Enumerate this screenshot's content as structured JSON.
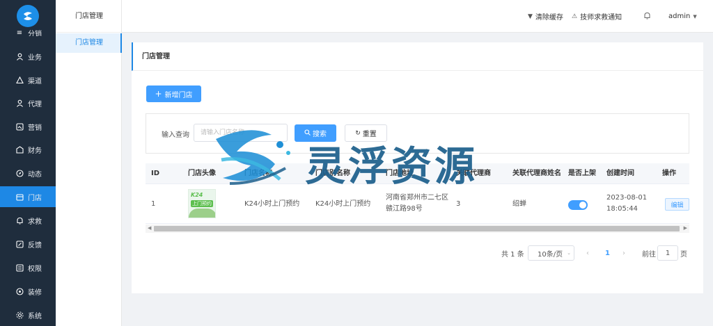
{
  "nav": {
    "partial_item": "分销",
    "items": [
      {
        "label": "业务",
        "icon": "user-icon"
      },
      {
        "label": "渠道",
        "icon": "share-icon"
      },
      {
        "label": "代理",
        "icon": "agent-icon"
      },
      {
        "label": "营销",
        "icon": "marketing-icon"
      },
      {
        "label": "财务",
        "icon": "finance-icon"
      },
      {
        "label": "动态",
        "icon": "compass-icon"
      },
      {
        "label": "门店",
        "icon": "store-icon"
      },
      {
        "label": "求救",
        "icon": "bell-icon"
      },
      {
        "label": "反馈",
        "icon": "feedback-icon"
      },
      {
        "label": "权限",
        "icon": "permission-icon"
      },
      {
        "label": "装修",
        "icon": "decoration-icon"
      },
      {
        "label": "系统",
        "icon": "settings-icon"
      }
    ],
    "active_index": 6
  },
  "subnav": {
    "title": "门店管理",
    "items": [
      {
        "label": "门店管理"
      }
    ]
  },
  "topbar": {
    "clear_cache": "清除缓存",
    "notice": "技师求救通知",
    "user": "admin"
  },
  "page": {
    "title": "门店管理",
    "add_button": "新增门店"
  },
  "filter": {
    "label": "输入查询",
    "placeholder": "请输入门店名称",
    "search_button": "搜索",
    "reset_button": "重置"
  },
  "table": {
    "columns": [
      "ID",
      "门店头像",
      "门店名称",
      "门店别名称",
      "门店地址",
      "关联代理商",
      "关联代理商姓名",
      "是否上架",
      "创建时间",
      "操作"
    ],
    "rows": [
      {
        "id": "1",
        "avatar_text": "K24",
        "avatar_sub": "上门预约",
        "name": "K24小时上门预约",
        "alias": "K24小时上门预约",
        "address_line1": "河南省郑州市二七区",
        "address_line2": "赣江路98号",
        "agent_id": "3",
        "agent_name": "绍蝉",
        "on_shelf": true,
        "created_date": "2023-08-01",
        "created_time": "18:05:44",
        "action": "编辑"
      }
    ]
  },
  "pagination": {
    "total": "共 1 条",
    "page_size": "10条/页",
    "current": "1",
    "goto_label": "前往",
    "goto_value": "1",
    "page_unit": "页"
  },
  "watermark": {
    "text": "灵浮资源"
  },
  "colors": {
    "primary": "#409eff",
    "nav_bg": "#1f2d3d",
    "nav_active": "#1e88e5"
  }
}
